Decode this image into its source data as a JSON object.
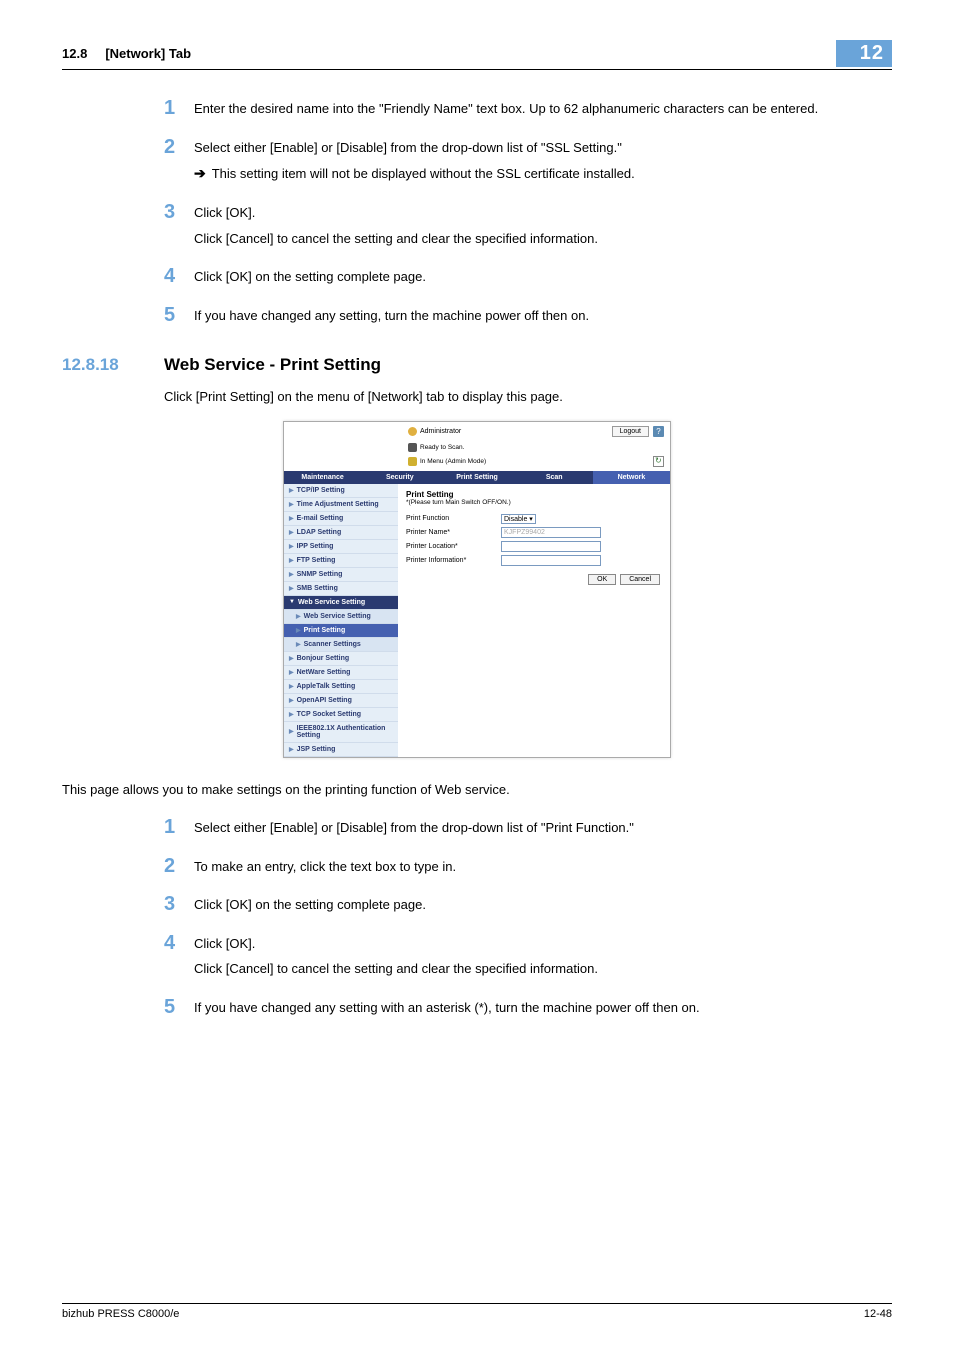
{
  "header": {
    "section": "12.8",
    "title": "[Network] Tab",
    "box": "12"
  },
  "steps_a": [
    {
      "n": "1",
      "t": "Enter the desired name into the \"Friendly Name\" text box. Up to 62 alphanumeric characters can be entered."
    },
    {
      "n": "2",
      "t": "Select either [Enable] or [Disable] from the drop-down list of \"SSL Setting.\"",
      "sub": "This setting item will not be displayed without the SSL certificate installed."
    },
    {
      "n": "3",
      "t": "Click [OK].",
      "t2": "Click [Cancel] to cancel the setting and clear the specified information."
    },
    {
      "n": "4",
      "t": "Click [OK] on the setting complete page."
    },
    {
      "n": "5",
      "t": "If you have changed any setting, turn the machine power off then on."
    }
  ],
  "section": {
    "num": "12.8.18",
    "title": "Web Service - Print Setting",
    "intro": "Click [Print Setting] on the menu of [Network] tab to display this page."
  },
  "ss": {
    "user": "Administrator",
    "logout": "Logout",
    "status1": "Ready to Scan.",
    "status2": "In Menu (Admin Mode)",
    "tabs": [
      "Maintenance",
      "Security",
      "Print Setting",
      "Scan",
      "Network"
    ],
    "active_tab": 4,
    "sidebar": [
      {
        "l": "TCP/IP Setting"
      },
      {
        "l": "Time Adjustment Setting"
      },
      {
        "l": "E-mail Setting"
      },
      {
        "l": "LDAP Setting"
      },
      {
        "l": "IPP Setting"
      },
      {
        "l": "FTP Setting"
      },
      {
        "l": "SNMP Setting"
      },
      {
        "l": "SMB Setting"
      },
      {
        "l": "Web Service Setting",
        "open": true
      },
      {
        "l": "Web Service Setting",
        "sub": true
      },
      {
        "l": "Print Setting",
        "sub": true,
        "active": true
      },
      {
        "l": "Scanner Settings",
        "sub": true
      },
      {
        "l": "Bonjour Setting"
      },
      {
        "l": "NetWare Setting"
      },
      {
        "l": "AppleTalk Setting"
      },
      {
        "l": "OpenAPI Setting"
      },
      {
        "l": "TCP Socket Setting"
      },
      {
        "l": "IEEE802.1X Authentication Setting"
      },
      {
        "l": "JSP Setting"
      }
    ],
    "main": {
      "title": "Print Setting",
      "note": "*(Please turn Main Switch OFF/ON.)",
      "rows": [
        {
          "l": "Print Function",
          "type": "select",
          "v": "Disable"
        },
        {
          "l": "Printer Name*",
          "type": "input",
          "v": "KJFPZ99402",
          "gray": true
        },
        {
          "l": "Printer Location*",
          "type": "input",
          "v": ""
        },
        {
          "l": "Printer Information*",
          "type": "input",
          "v": ""
        }
      ],
      "ok": "OK",
      "cancel": "Cancel"
    }
  },
  "after_ss_para": "This page allows you to make settings on the printing function of Web service.",
  "steps_b": [
    {
      "n": "1",
      "t": "Select either [Enable] or [Disable] from the drop-down list of \"Print Function.\""
    },
    {
      "n": "2",
      "t": "To make an entry, click the text box to type in."
    },
    {
      "n": "3",
      "t": "Click [OK] on the setting complete page."
    },
    {
      "n": "4",
      "t": "Click [OK].",
      "t2": "Click [Cancel] to cancel the setting and clear the specified information."
    },
    {
      "n": "5",
      "t": "If you have changed any setting with an asterisk (*), turn the machine power off then on."
    }
  ],
  "footer": {
    "left": "bizhub PRESS C8000/e",
    "right": "12-48"
  }
}
